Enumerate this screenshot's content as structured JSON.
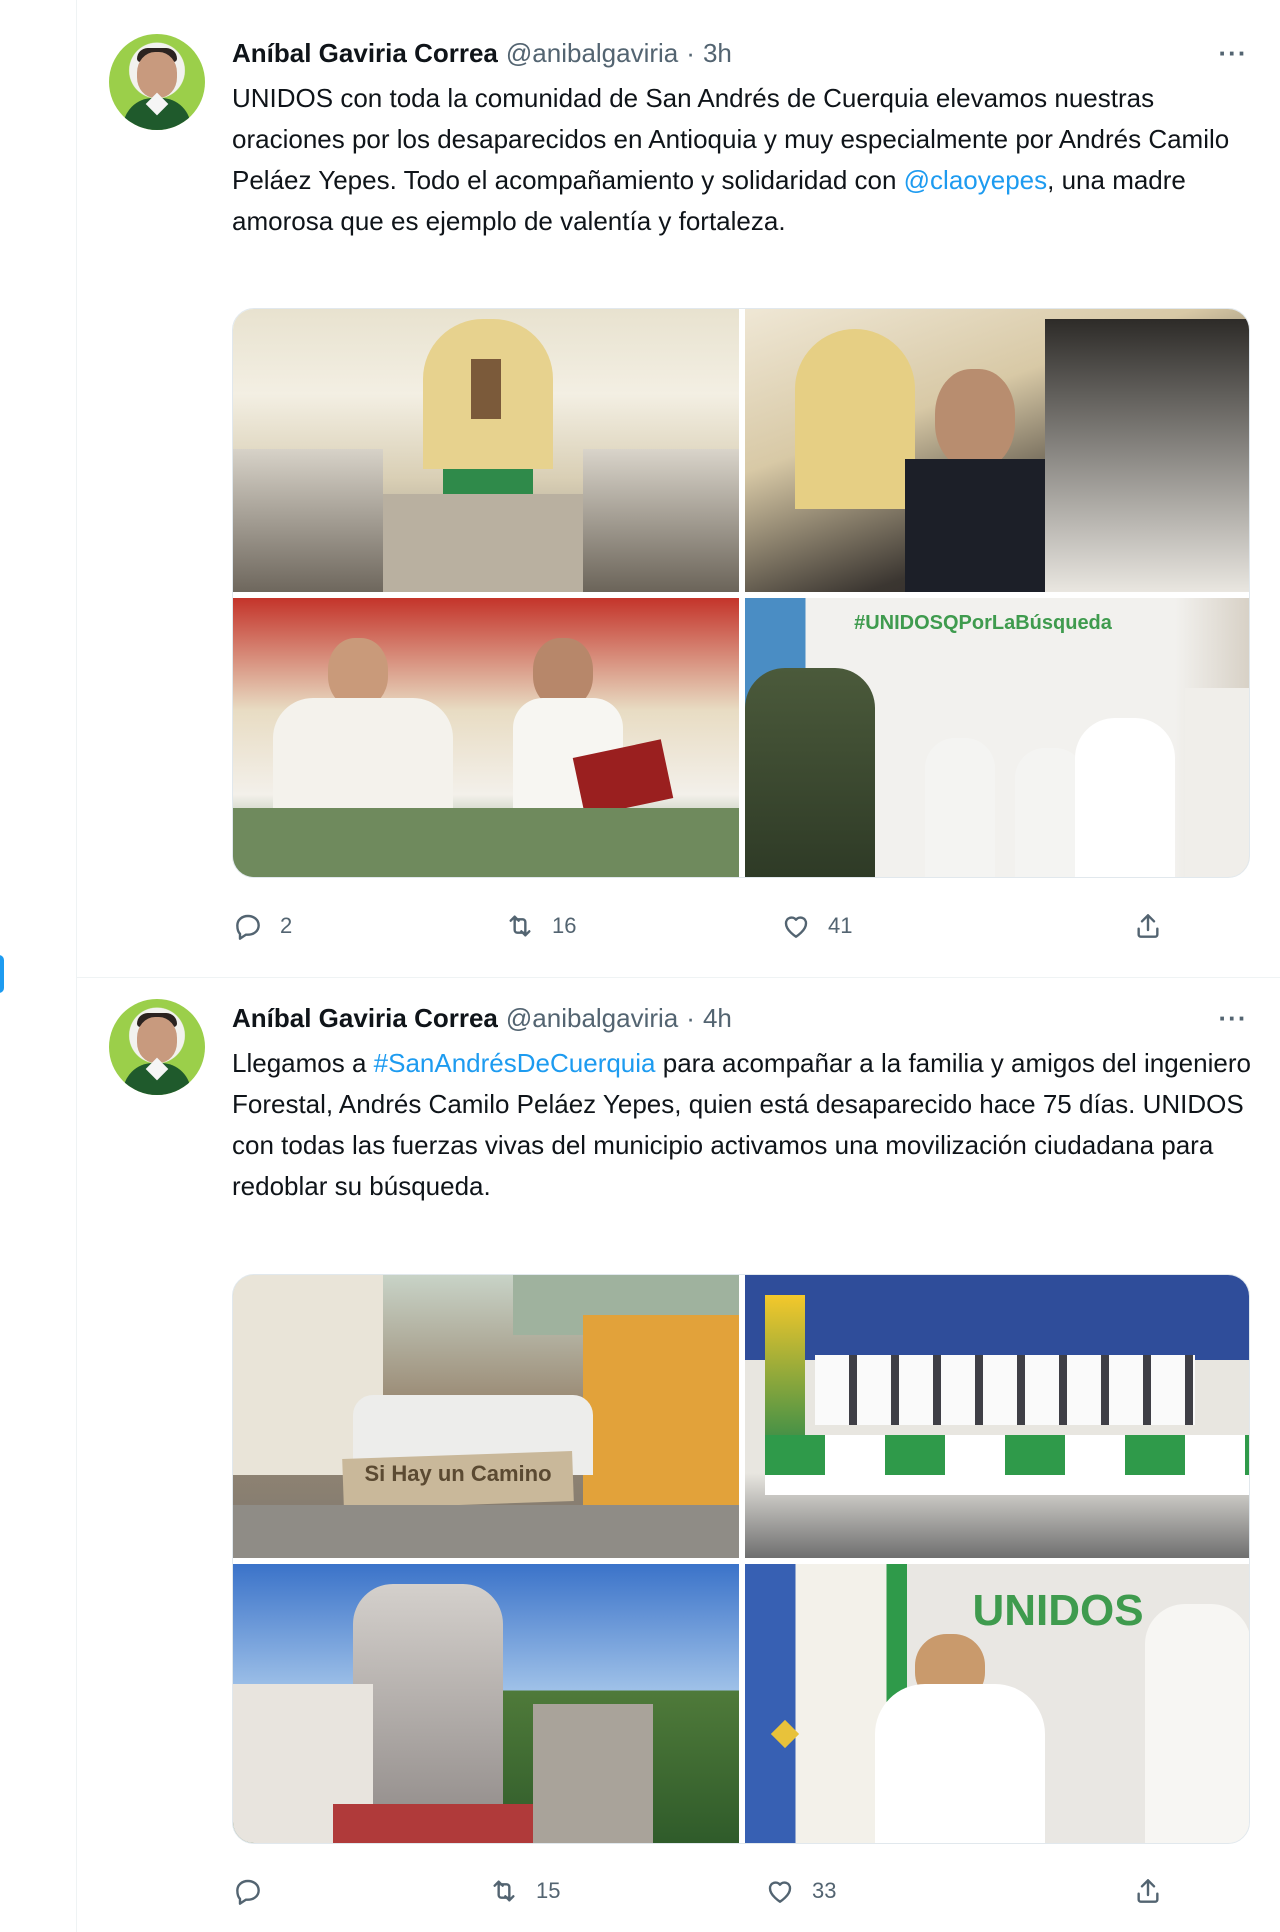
{
  "tweets": [
    {
      "author_name": "Aníbal Gaviria Correa",
      "handle": "@anibalgaviria",
      "separator": "·",
      "time": "3h",
      "more_label": "···",
      "text_parts": [
        "UNIDOS con toda la comunidad de San Andrés de Cuerquia elevamos nuestras oraciones por los desaparecidos en Antioquia y muy especialmente por Andrés Camilo Peláez Yepes. Todo el acompañamiento y solidaridad con ",
        "@claoyepes",
        ", una madre amorosa que es ejemplo de valentía y fortaleza."
      ],
      "photo_banner_text": "#UNIDOSQPorLaBúsqueda",
      "replies": "2",
      "retweets": "16",
      "likes": "41"
    },
    {
      "author_name": "Aníbal Gaviria Correa",
      "handle": "@anibalgaviria",
      "separator": "·",
      "time": "4h",
      "more_label": "···",
      "text_parts": [
        "Llegamos a ",
        "#SanAndrésDeCuerquia",
        " para acompañar a la familia y amigos del ingeniero Forestal, Andrés Camilo Peláez Yepes, quien está desaparecido hace 75 días. UNIDOS con todas las fuerzas vivas del municipio activamos una movilización ciudadana para redoblar su búsqueda."
      ],
      "photo_banner_text": "Si Hay un Camino",
      "photo_unidos_text": "UNIDOS",
      "replies": "",
      "retweets": "15",
      "likes": "33"
    }
  ],
  "colors": {
    "accent": "#1d9bf0",
    "secondary_text": "#536471",
    "primary_text": "#0f1419",
    "divider": "#eff3f4",
    "avatar_bg": "#9bcf4a"
  }
}
